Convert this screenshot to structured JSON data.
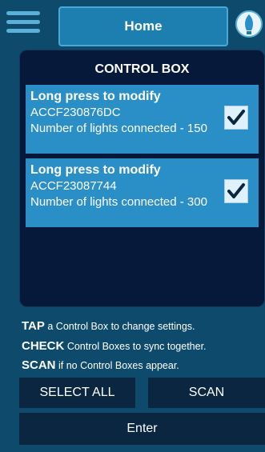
{
  "header": {
    "title": "Home",
    "menu_icon": "hamburger-menu-icon",
    "bulb_icon": "light-bulb-icon"
  },
  "panel": {
    "title": "CONTROL BOX",
    "items": [
      {
        "heading": "Long press to modify",
        "code": "ACCF230876DC",
        "lights_label": "Number of lights connected - 150",
        "checked": true
      },
      {
        "heading": "Long press to modify",
        "code": "ACCF23087744",
        "lights_label": "Number of lights connected - 300",
        "checked": true
      }
    ]
  },
  "help": [
    {
      "keyword": "TAP",
      "text": " a Control Box to change settings."
    },
    {
      "keyword": "CHECK",
      "text": " Control Boxes to sync together."
    },
    {
      "keyword": "SCAN",
      "text": " if no Control Boxes appear."
    }
  ],
  "buttons": {
    "select_all": "SELECT ALL",
    "scan": "SCAN",
    "enter": "Enter"
  },
  "colors": {
    "background": "#0e4a6b",
    "panel": "#06193a",
    "item": "#2b8fc7",
    "accent": "#1d7fb0",
    "button": "#0a2640"
  }
}
